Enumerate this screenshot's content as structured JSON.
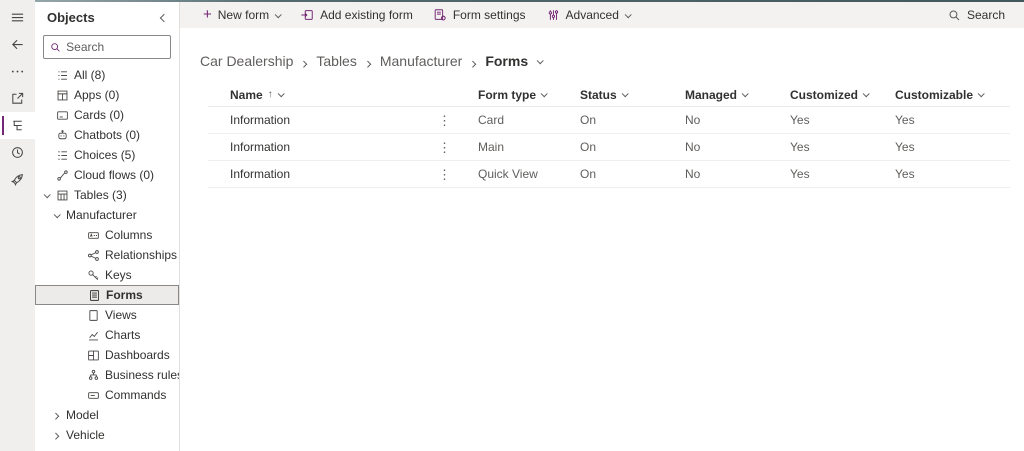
{
  "colors": {
    "accent": "#742774",
    "toolbar_bg": "#f3f2f1",
    "selected_bg": "#edebe9",
    "text_primary": "#323130",
    "text_secondary": "#605e5c"
  },
  "icons": {
    "menu-icon": "three horizontal lines",
    "back-icon": "left arrow",
    "more-icon": "horizontal ellipsis",
    "open-window-icon": "square with outgoing arrow",
    "tree-view-icon": "indented list (active view)",
    "history-icon": "clock",
    "rocket-icon": "rocket",
    "search-icon": "magnifier",
    "chevron": "thin chevron",
    "row-menu-icon": "vertical ellipsis"
  },
  "rail": {
    "active_item": "tree-view"
  },
  "sidebar": {
    "title": "Objects",
    "search_placeholder": "Search",
    "items": [
      {
        "label": "All (8)"
      },
      {
        "label": "Apps (0)"
      },
      {
        "label": "Cards (0)"
      },
      {
        "label": "Chatbots (0)"
      },
      {
        "label": "Choices (5)"
      },
      {
        "label": "Cloud flows (0)"
      },
      {
        "label": "Tables (3)"
      },
      {
        "label": "Manufacturer"
      },
      {
        "label": "Columns"
      },
      {
        "label": "Relationships"
      },
      {
        "label": "Keys"
      },
      {
        "label": "Forms"
      },
      {
        "label": "Views"
      },
      {
        "label": "Charts"
      },
      {
        "label": "Dashboards"
      },
      {
        "label": "Business rules"
      },
      {
        "label": "Commands"
      },
      {
        "label": "Model"
      },
      {
        "label": "Vehicle"
      }
    ],
    "selected_item": "Forms"
  },
  "toolbar": {
    "new_form": "New form",
    "add_existing_form": "Add existing form",
    "form_settings": "Form settings",
    "advanced": "Advanced",
    "search": "Search"
  },
  "breadcrumb": {
    "items": [
      "Car Dealership",
      "Tables",
      "Manufacturer"
    ],
    "current": "Forms"
  },
  "table": {
    "columns": [
      "Name",
      "Form type",
      "Status",
      "Managed",
      "Customized",
      "Customizable"
    ],
    "sorted_by": "Name ascending",
    "rows": [
      {
        "name": "Information",
        "form_type": "Card",
        "status": "On",
        "managed": "No",
        "customized": "Yes",
        "customizable": "Yes"
      },
      {
        "name": "Information",
        "form_type": "Main",
        "status": "On",
        "managed": "No",
        "customized": "Yes",
        "customizable": "Yes"
      },
      {
        "name": "Information",
        "form_type": "Quick View",
        "status": "On",
        "managed": "No",
        "customized": "Yes",
        "customizable": "Yes"
      }
    ]
  }
}
